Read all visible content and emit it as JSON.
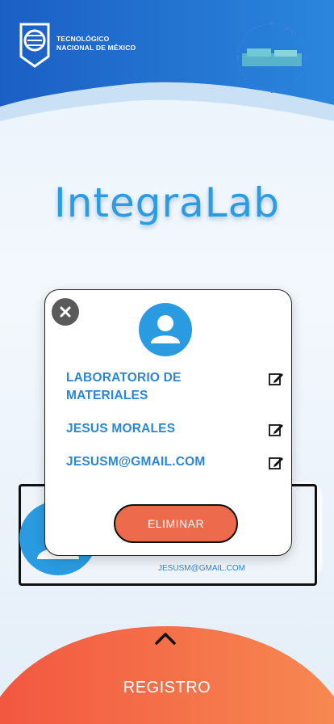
{
  "header": {
    "institution_line1": "TECNOLÓGICO",
    "institution_line2": "NACIONAL DE MÉXICO"
  },
  "app": {
    "title": "IntegraLab"
  },
  "background_card": {
    "email": "JESUSM@GMAIL.COM"
  },
  "modal": {
    "fields": [
      {
        "value": "LABORATORIO DE MATERIALES"
      },
      {
        "value": "JESUS MORALES"
      },
      {
        "value": "JESUSM@GMAIL.COM"
      }
    ],
    "delete_label": "ELIMINAR"
  },
  "footer": {
    "register_label": "REGISTRO"
  },
  "colors": {
    "primary_blue": "#2a9be0",
    "accent_orange": "#ee6a4c",
    "header_blue": "#1b63c6"
  },
  "icons": [
    "close-icon",
    "user-icon",
    "edit-icon",
    "chevron-up-icon"
  ]
}
